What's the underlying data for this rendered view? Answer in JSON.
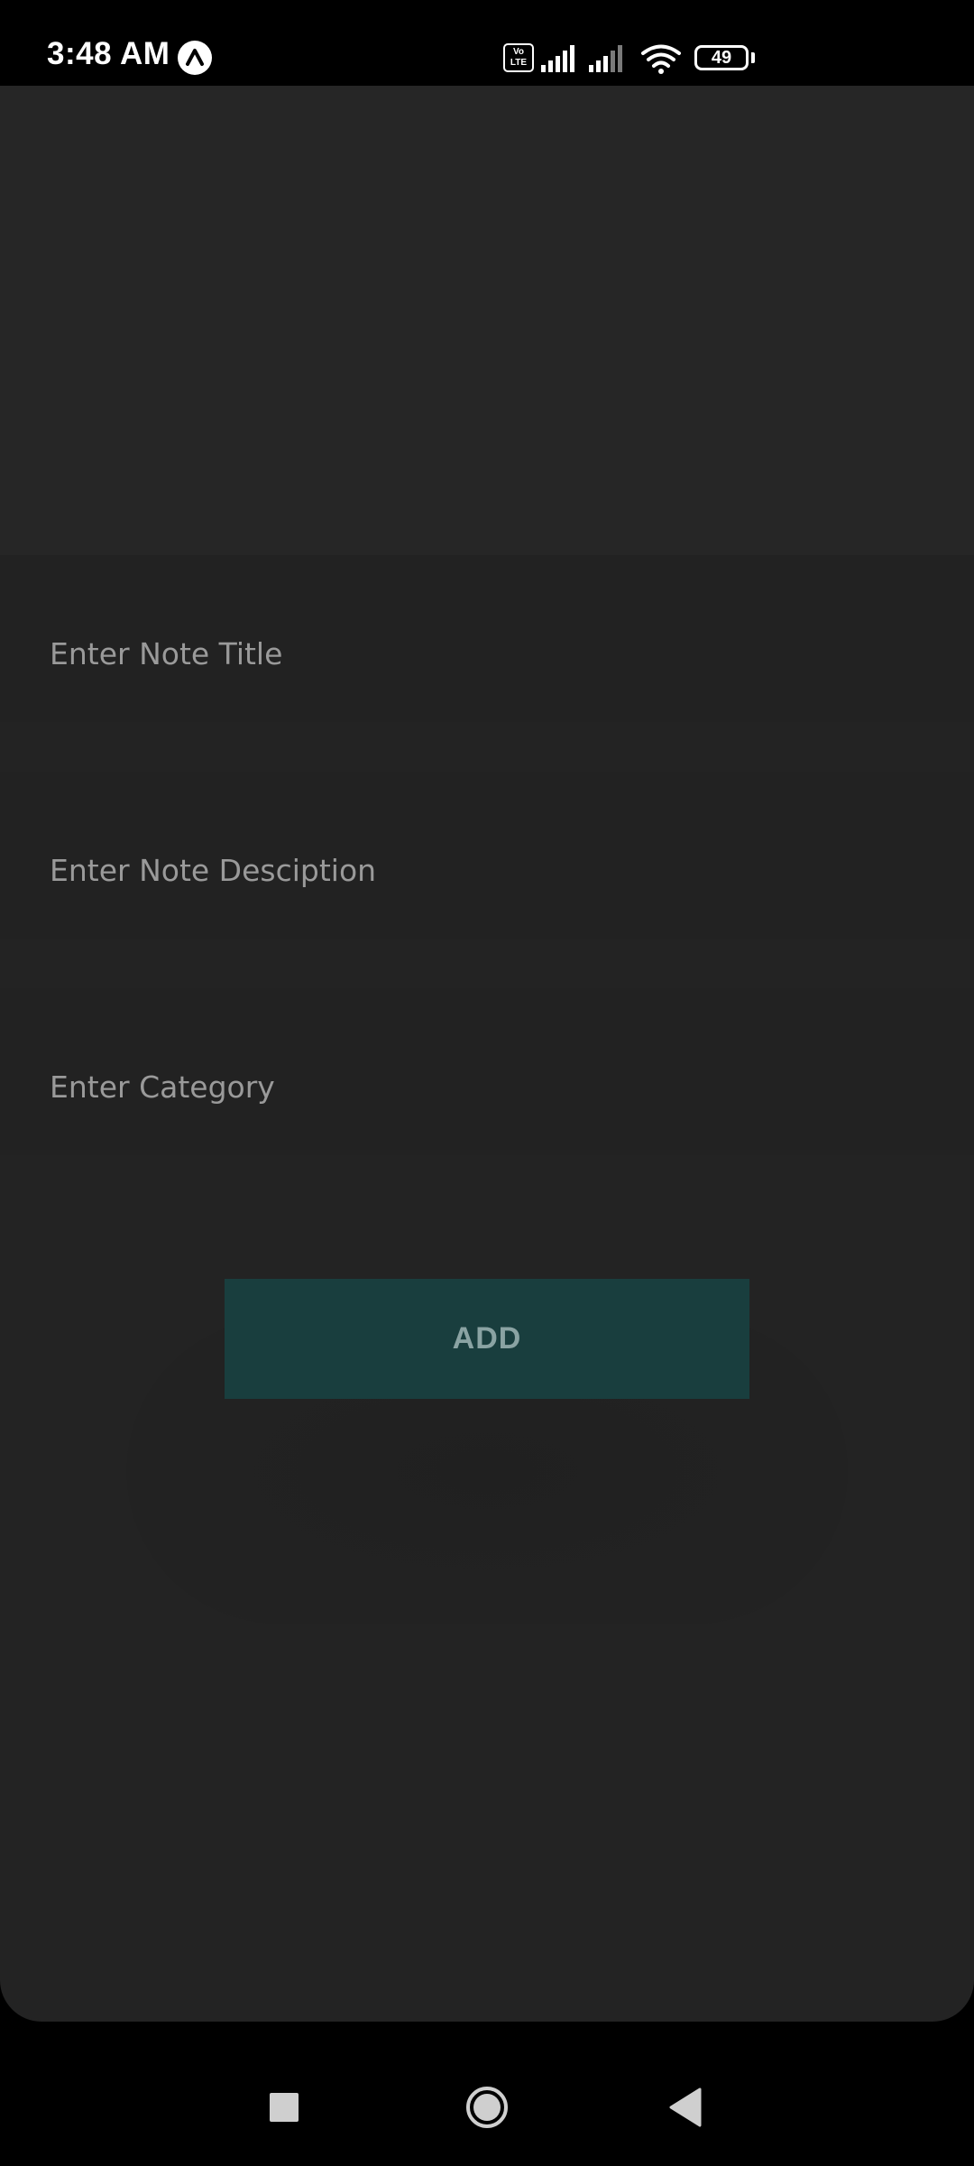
{
  "status_bar": {
    "time": "3:48 AM",
    "volte": [
      "Vo",
      "LTE"
    ],
    "battery": "49",
    "icons": [
      "app-notification-icon",
      "volte-icon",
      "signal-icon",
      "signal-icon",
      "wifi-icon",
      "battery-icon"
    ]
  },
  "form": {
    "title_placeholder": "Enter Note Title",
    "description_placeholder": "Enter Note Desciption",
    "category_placeholder": "Enter Category",
    "add_label": "ADD"
  },
  "navigation": {
    "icons": [
      "recents-icon",
      "home-icon",
      "back-icon"
    ]
  },
  "colors": {
    "background": "#232323",
    "button": "#193e3e",
    "button_text": "#8aa3a3",
    "placeholder": "#9a9a9a"
  }
}
